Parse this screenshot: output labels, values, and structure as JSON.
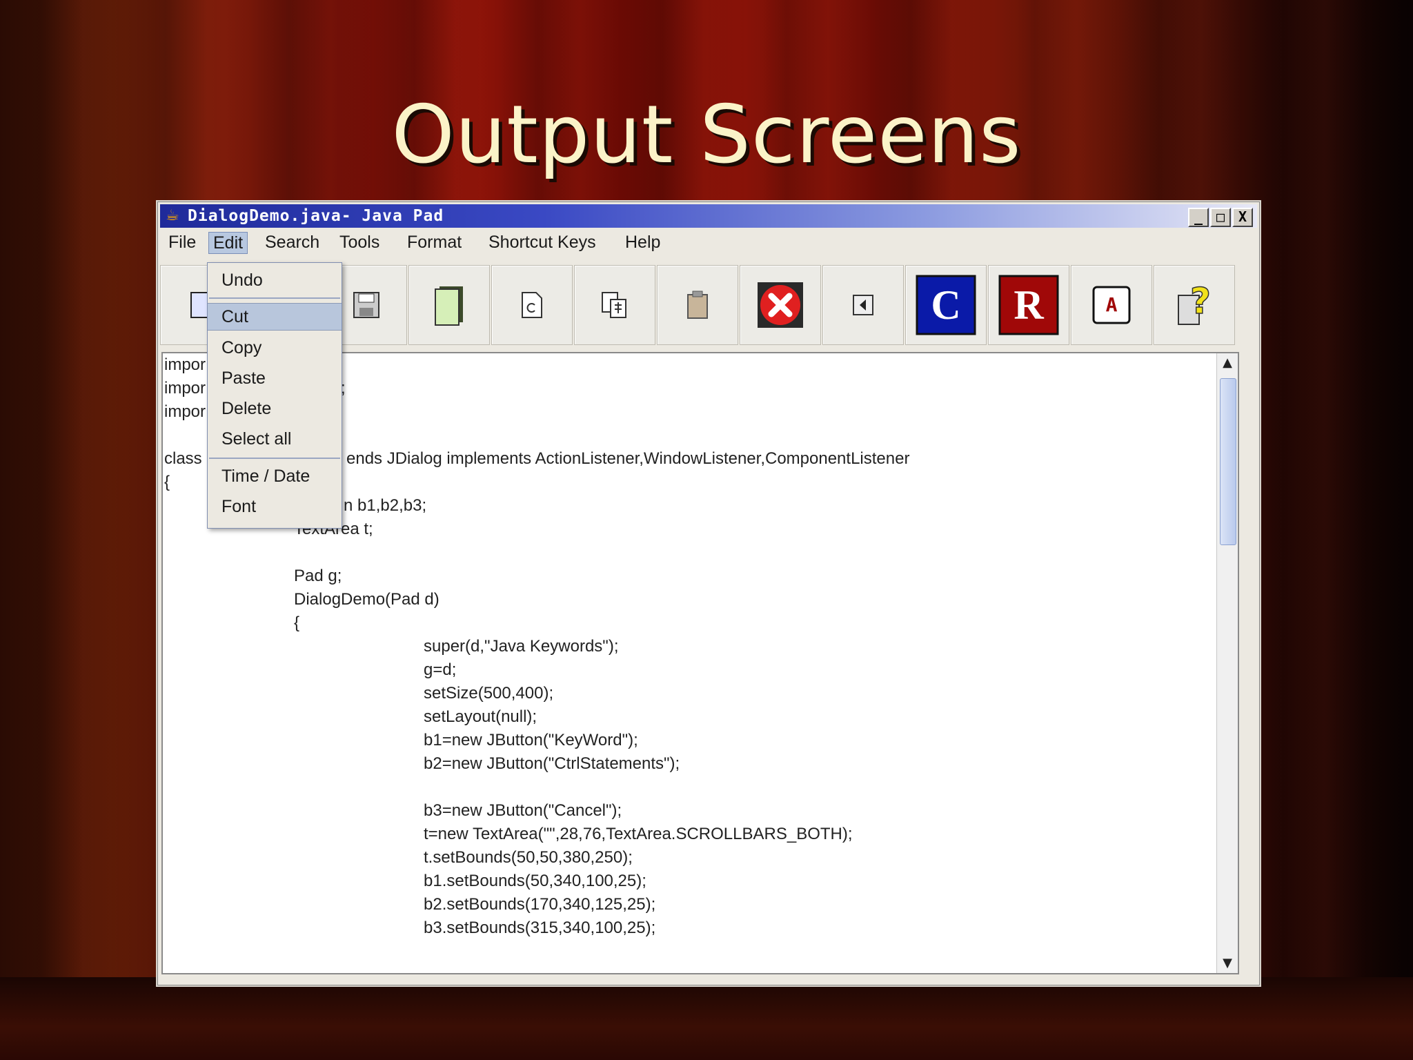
{
  "slide": {
    "title": "Output Screens"
  },
  "window": {
    "title": "DialogDemo.java- Java Pad",
    "controls": {
      "minimize": "_",
      "maximize": "□",
      "close": "X"
    }
  },
  "menubar": {
    "items": [
      {
        "label": "File"
      },
      {
        "label": "Edit"
      },
      {
        "label": "Search"
      },
      {
        "label": "Tools"
      },
      {
        "label": "Format"
      },
      {
        "label": "Shortcut Keys"
      },
      {
        "label": "Help"
      }
    ]
  },
  "edit_menu": {
    "items": [
      {
        "label": "Undo"
      },
      {
        "label": "Cut"
      },
      {
        "label": "Copy"
      },
      {
        "label": "Paste"
      },
      {
        "label": "Delete"
      },
      {
        "label": "Select all"
      },
      {
        "label": "Time / Date"
      },
      {
        "label": "Font"
      }
    ]
  },
  "toolbar": {
    "buttons": [
      {
        "icon": "new-file-icon"
      },
      {
        "icon": "save-icon"
      },
      {
        "icon": "copy-pages-icon"
      },
      {
        "icon": "refresh-document-icon"
      },
      {
        "icon": "print-preview-icon"
      },
      {
        "icon": "clipboard-icon"
      },
      {
        "icon": "exit-icon"
      },
      {
        "icon": "back-arrow-icon"
      },
      {
        "icon": "compile-icon",
        "glyph": "C"
      },
      {
        "icon": "run-icon",
        "glyph": "R"
      },
      {
        "icon": "font-icon",
        "glyph": "A"
      },
      {
        "icon": "help-icon",
        "glyph": "?"
      }
    ]
  },
  "editor": {
    "lines": [
      "impor",
      "impor",
      "impor",
      "",
      "class",
      "{",
      "",
      "TextArea t;",
      "",
      "Pad g;",
      "DialogDemo(Pad d)",
      "{",
      "super(d,\"Java Keywords\");",
      "g=d;",
      "setSize(500,400);",
      "setLayout(null);",
      "b1=new JButton(\"KeyWord\");",
      "b2=new JButton(\"CtrlStatements\");",
      "",
      "b3=new JButton(\"Cancel\");",
      "t=new TextArea(\"\",28,76,TextArea.SCROLLBARS_BOTH);",
      "t.setBounds(50,50,380,250);",
      "b1.setBounds(50,340,100,25);",
      "b2.setBounds(170,340,125,25);",
      "b3.setBounds(315,340,100,25);"
    ],
    "partial": {
      "l2_tail": ";",
      "l5_tail": "ends JDialog implements ActionListener,WindowListener,ComponentListener",
      "l7_tail": "n b1,b2,b3;"
    }
  },
  "colors": {
    "title_text": "#fbf3c8",
    "titlebar_start": "#1f2a9a",
    "menu_highlight": "#b8c6dc",
    "exit_button": "#e02020",
    "compile_bg": "#0a1aa8",
    "run_bg": "#a00808"
  }
}
